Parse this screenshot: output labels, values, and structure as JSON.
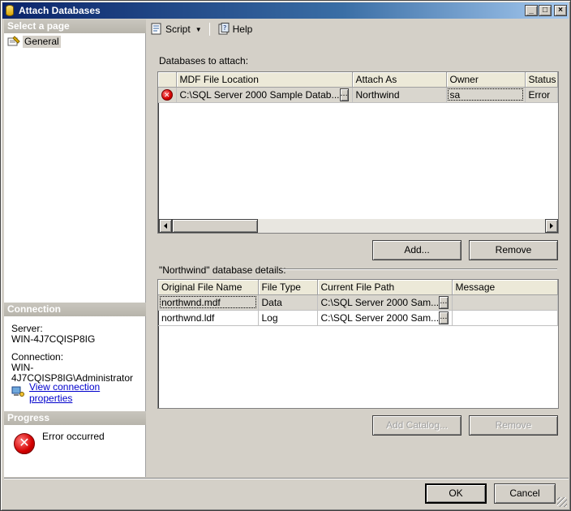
{
  "window": {
    "title": "Attach Databases"
  },
  "left": {
    "select_page_header": "Select a page",
    "pages": [
      {
        "label": "General"
      }
    ],
    "connection_header": "Connection",
    "server_label": "Server:",
    "server_value": "WIN-4J7CQISP8IG",
    "connection_label": "Connection:",
    "connection_value": "WIN-4J7CQISP8IG\\Administrator",
    "view_props_link": "View connection properties",
    "progress_header": "Progress",
    "progress_status": "Error occurred"
  },
  "toolbar": {
    "script_label": "Script",
    "help_label": "Help"
  },
  "databases": {
    "caption": "Databases to attach:",
    "columns": [
      "MDF File Location",
      "Attach As",
      "Owner",
      "Status"
    ],
    "rows": [
      {
        "mdf": "C:\\SQL Server 2000 Sample Datab...",
        "attach_as": "Northwind",
        "owner": "sa",
        "status": "Error"
      }
    ],
    "add_button": "Add...",
    "remove_button": "Remove"
  },
  "details": {
    "caption": "\"Northwind\" database details:",
    "columns": [
      "Original File Name",
      "File Type",
      "Current File Path",
      "Message"
    ],
    "rows": [
      {
        "name": "northwnd.mdf",
        "type": "Data",
        "path": "C:\\SQL Server 2000 Sam...",
        "message": ""
      },
      {
        "name": "northwnd.ldf",
        "type": "Log",
        "path": "C:\\SQL Server 2000 Sam...",
        "message": ""
      }
    ],
    "add_catalog_button": "Add Catalog...",
    "remove_button": "Remove"
  },
  "footer": {
    "ok_button": "OK",
    "cancel_button": "Cancel"
  },
  "cell_button_label": "..."
}
